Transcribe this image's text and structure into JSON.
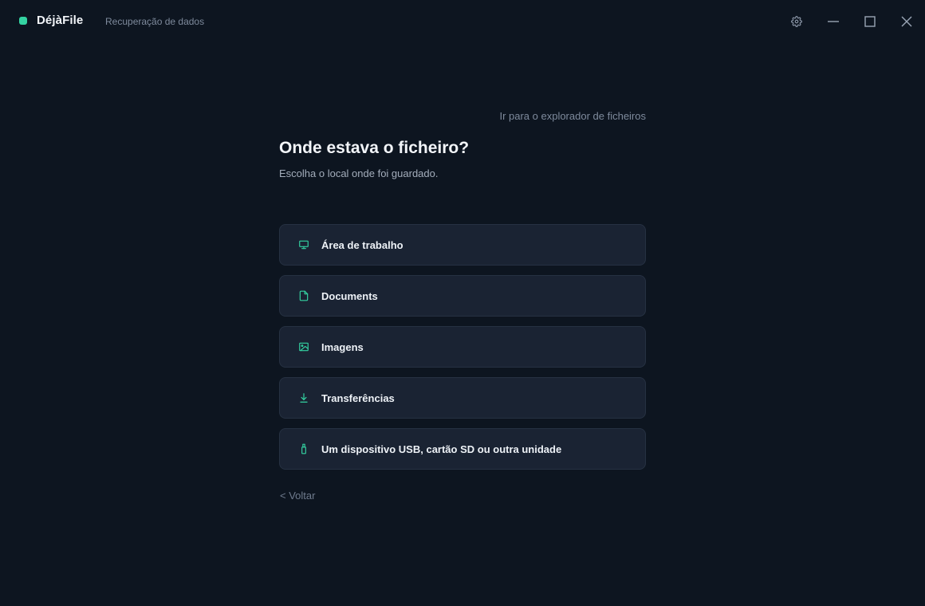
{
  "app": {
    "name": "DéjàFile",
    "subtitle": "Recuperação de dados",
    "accent_color": "#34d3a2"
  },
  "window_controls": {
    "icons": [
      "gear-icon",
      "minimize-icon",
      "maximize-icon",
      "close-icon"
    ]
  },
  "page": {
    "explorer_link": "Ir para o explorador de ficheiros",
    "title": "Onde estava o ficheiro?",
    "subtitle": "Escolha o local onde foi guardado.",
    "back_label": "< Voltar"
  },
  "options": [
    {
      "label": "Área de trabalho",
      "icon": "monitor-icon"
    },
    {
      "label": "Documents",
      "icon": "document-icon"
    },
    {
      "label": "Imagens",
      "icon": "image-icon"
    },
    {
      "label": "Transferências",
      "icon": "download-icon"
    },
    {
      "label": "Um dispositivo USB, cartão SD ou outra unidade",
      "icon": "usb-drive-icon"
    }
  ]
}
